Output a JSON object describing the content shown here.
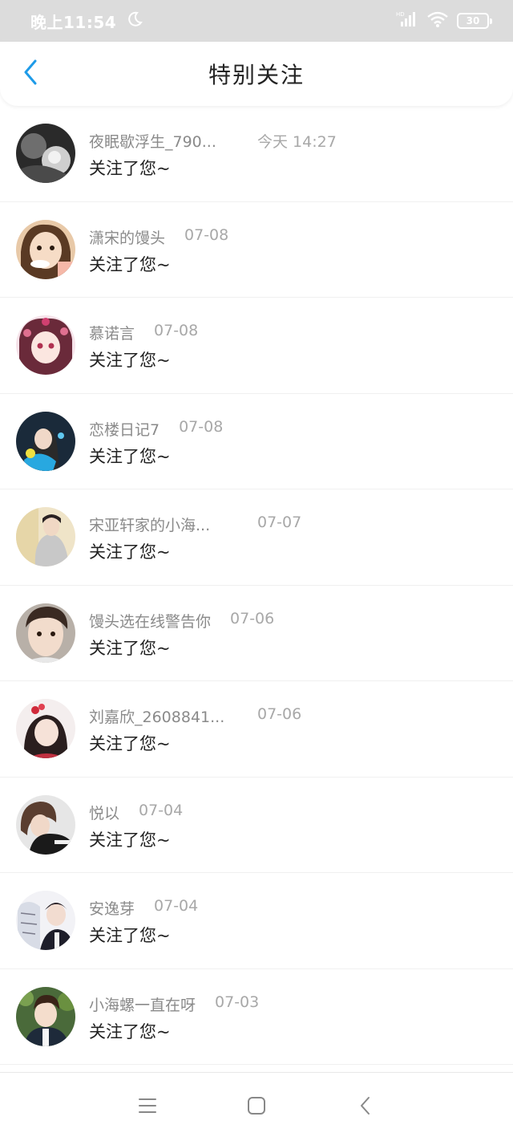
{
  "status_bar": {
    "time": "晚上11:54",
    "moon_icon": "moon-icon",
    "signal_label": "HD",
    "battery": "30"
  },
  "header": {
    "title": "特别关注",
    "back_icon": "chevron-left-icon"
  },
  "colors": {
    "accent": "#1e9be8",
    "status_bar_bg": "#dcdcdc",
    "primary_text": "#222222",
    "secondary_text": "#8a8a8a"
  },
  "items": [
    {
      "name": "夜眠歇浮生_790...",
      "time": "今天 14:27",
      "message": "关注了您~"
    },
    {
      "name": "潇宋的馒头",
      "time": "07-08",
      "message": "关注了您~"
    },
    {
      "name": "慕诺言",
      "time": "07-08",
      "message": "关注了您~"
    },
    {
      "name": "恋楼日记7",
      "time": "07-08",
      "message": "关注了您~"
    },
    {
      "name": "宋亚轩家的小海...",
      "time": "07-07",
      "message": "关注了您~"
    },
    {
      "name": "馒头选在线警告你",
      "time": "07-06",
      "message": "关注了您~"
    },
    {
      "name": "刘嘉欣_2608841...",
      "time": "07-06",
      "message": "关注了您~"
    },
    {
      "name": "悦以",
      "time": "07-04",
      "message": "关注了您~"
    },
    {
      "name": "安逸芽",
      "time": "07-04",
      "message": "关注了您~"
    },
    {
      "name": "小海螺一直在呀",
      "time": "07-03",
      "message": "关注了您~"
    }
  ],
  "nav": {
    "menu_icon": "menu-icon",
    "home_icon": "home-square-icon",
    "back_icon": "back-chevron-icon"
  }
}
